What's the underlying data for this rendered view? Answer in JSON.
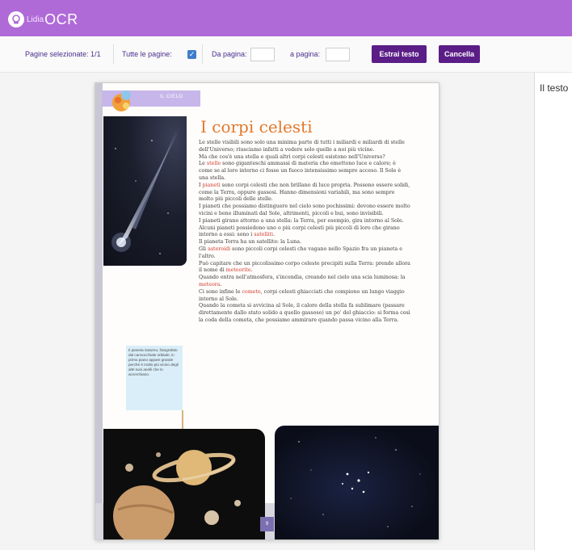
{
  "app": {
    "logo_small": "Lidia",
    "logo_big": "OCR"
  },
  "toolbar": {
    "pages_selected": "Pagine selezionate: 1/1",
    "all_pages_label": "Tutte le pagine:",
    "all_pages_checked": true,
    "from_page_label": "Da pagina:",
    "from_page_value": "",
    "to_page_label": "a pagina:",
    "to_page_value": "",
    "extract_button": "Estrai testo",
    "cancel_button": "Cancella"
  },
  "document": {
    "section_tab": "IL CIELO",
    "title": "I corpi celesti",
    "paragraphs": [
      [
        {
          "t": "Le stelle visibili sono solo una minima parte di tutti i miliardi e miliardi di stelle dell'Universo; riusciamo infatti a vedere solo quelle a noi più vicine."
        }
      ],
      [
        {
          "t": "Ma che cos'è una stella e quali altri corpi celesti esistono nell'Universo?"
        }
      ],
      [
        {
          "t": "Le "
        },
        {
          "t": "stelle",
          "h": true
        },
        {
          "t": " sono giganteschi ammassi di materia che emettono luce e calore; è come se al loro interno ci fosse un fuoco intensissimo sempre acceso. Il Sole è una stella."
        }
      ],
      [
        {
          "t": "I "
        },
        {
          "t": "pianeti",
          "h": true
        },
        {
          "t": " sono corpi celesti che non brillano di luce propria. Possono essere solidi, come la Terra, oppure gassosi. Hanno dimensioni variabili, ma sono sempre molto più piccoli delle stelle."
        }
      ],
      [
        {
          "t": "I pianeti che possiamo distinguere nel cielo sono pochissimi: devono essere molto vicini e bene illuminati dal Sole, altrimenti, piccoli e bui, sono invisibili."
        }
      ],
      [
        {
          "t": "I pianeti girano attorno a una stella: la Terra, per esempio, gira intorno al Sole. Alcuni pianeti possiedono uno o più corpi celesti più piccoli di loro che girano intorno a essi: sono i "
        },
        {
          "t": "satelliti",
          "h": true
        },
        {
          "t": "."
        }
      ],
      [
        {
          "t": "Il pianeta Terra ha un satellite: la Luna."
        }
      ],
      [
        {
          "t": "Gli "
        },
        {
          "t": "asteroidi",
          "h": true
        },
        {
          "t": " sono piccoli corpi celesti che vagano nello Spazio fra un pianeta e l'altro."
        }
      ],
      [
        {
          "t": "Può capitare che un piccolissimo corpo celeste precipiti sulla Terra: prende allora il nome di "
        },
        {
          "t": "meteorite",
          "h": true
        },
        {
          "t": "."
        }
      ],
      [
        {
          "t": "Quando entra nell'atmosfera, s'incendia, creando nel cielo una scia luminosa: la "
        },
        {
          "t": "meteora",
          "h": true
        },
        {
          "t": "."
        }
      ],
      [
        {
          "t": "Ci sono infine le "
        },
        {
          "t": "comete",
          "h": true
        },
        {
          "t": ", corpi celesti ghiacciati che compiono un lungo viaggio intorno al Sole."
        }
      ],
      [
        {
          "t": "Quando la cometa si avvicina al Sole, il calore della stella fa sublimare (passare direttamente dallo stato solido a quello gassoso) un po' del ghiaccio: si forma così la coda della cometa, che possiamo ammirare quando passa vicino alla Terra."
        }
      ]
    ],
    "caption": "Il pianeta Saturno, fotografato dal cannocchiale orbitale; in primo piano appare grande perché è molto più vicino degli altri suoi anelli che lo accerchiano.",
    "page_number": "9"
  },
  "right_panel": {
    "text": "Il testo"
  },
  "colors": {
    "header": "#b06ad8",
    "button": "#5b1e87",
    "title": "#e2782b",
    "highlight": "#d43a2e",
    "toolbar_text": "#4a2e8e"
  }
}
